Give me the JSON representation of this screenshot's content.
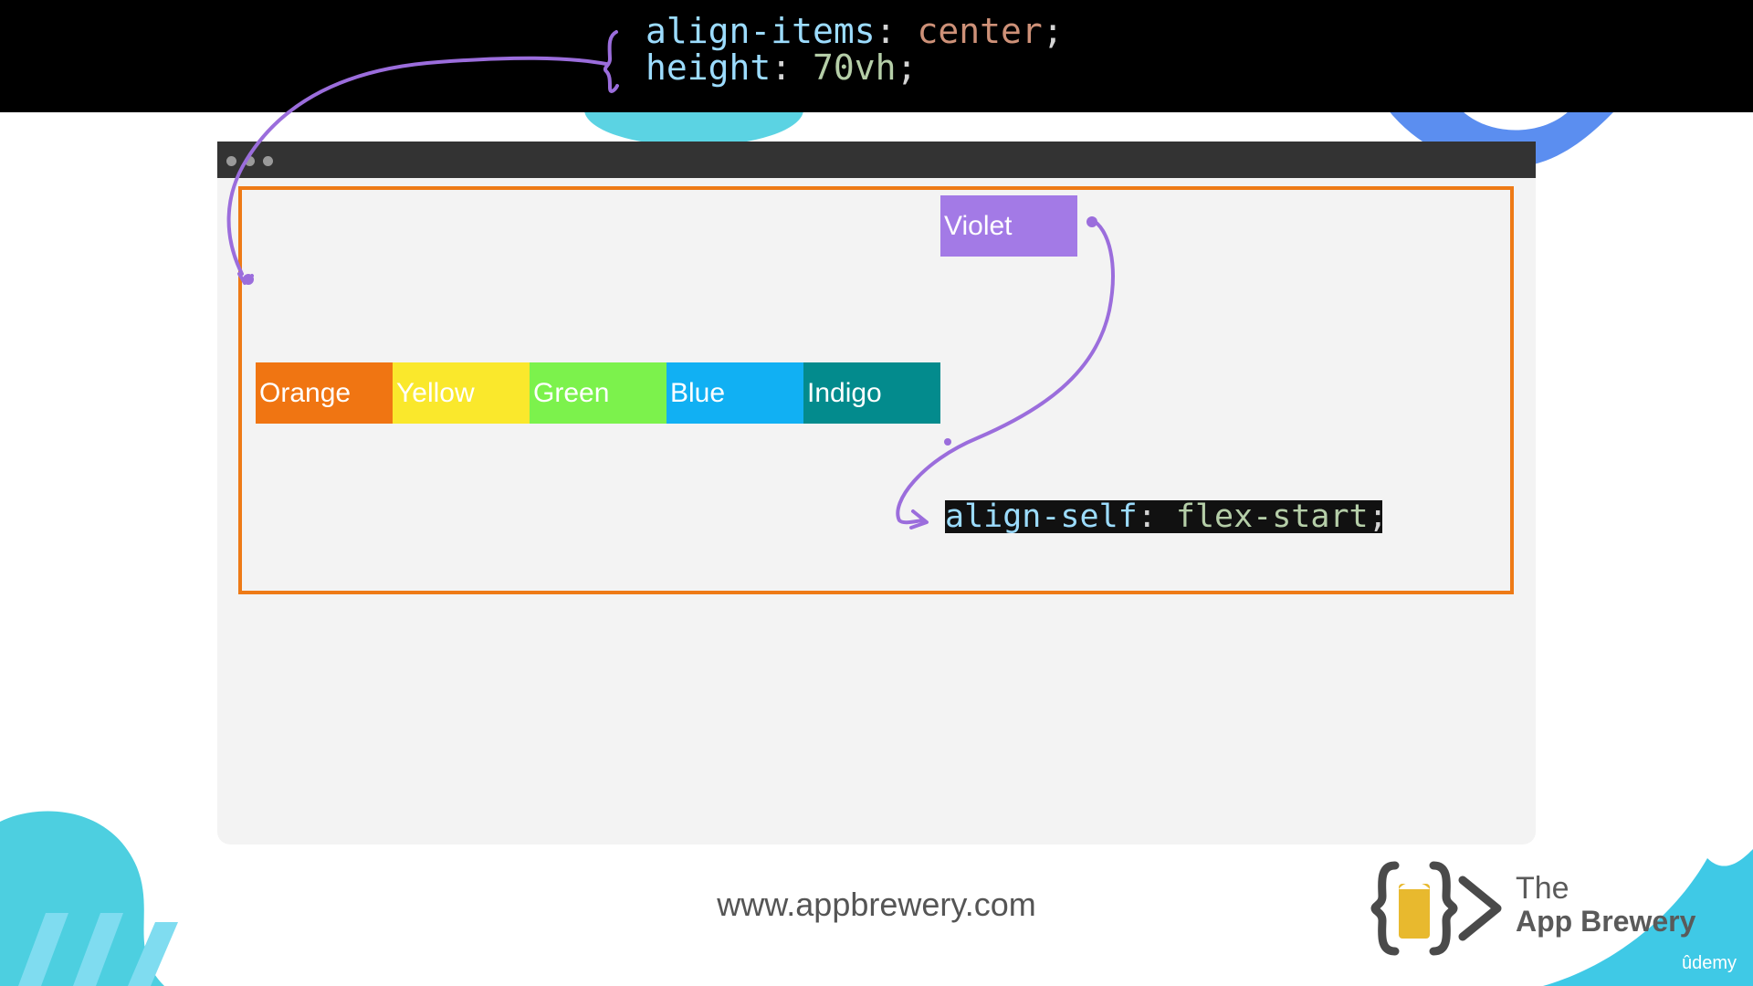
{
  "code_banner": {
    "line1": {
      "property": "align-items",
      "colon": ": ",
      "value": "center",
      "end": ";"
    },
    "line2": {
      "property": "height",
      "colon": ": ",
      "value": "70vh",
      "end": ";"
    }
  },
  "flex_items": [
    {
      "label": "Orange",
      "color": "#f07512"
    },
    {
      "label": "Yellow",
      "color": "#fae82c"
    },
    {
      "label": "Green",
      "color": "#7cf24c"
    },
    {
      "label": "Blue",
      "color": "#11b0f3"
    },
    {
      "label": "Indigo",
      "color": "#038b8d"
    },
    {
      "label": "Violet",
      "color": "#a37ae6"
    }
  ],
  "code_chip": {
    "property": "align-self",
    "colon": ": ",
    "value": "flex-start",
    "end": ";"
  },
  "footer": {
    "url": "www.appbrewery.com",
    "logo_line1": "The",
    "logo_line2": "App Brewery",
    "udemy": "ûdemy"
  },
  "colors": {
    "container_border": "#ee7a16",
    "annotation": "#9b6ddc",
    "accent_blue": "#4dd0e1"
  }
}
